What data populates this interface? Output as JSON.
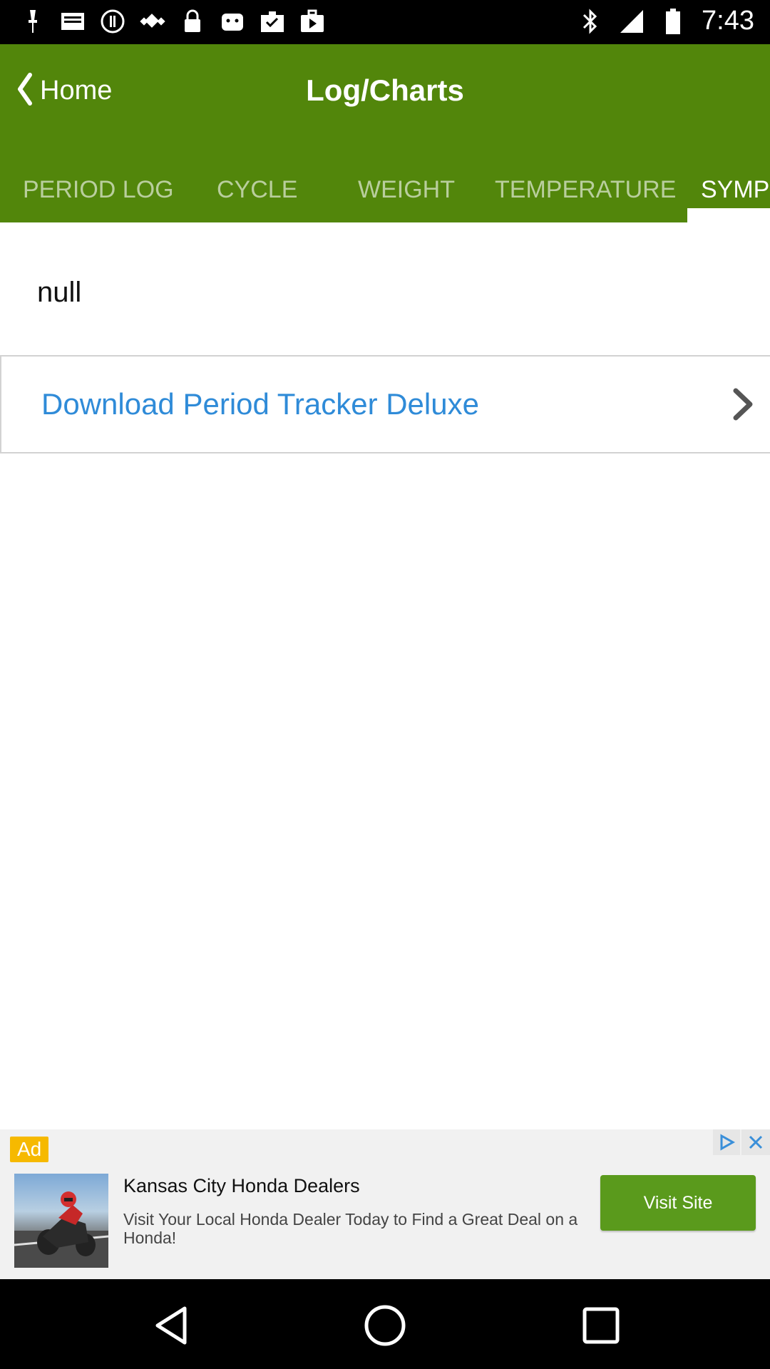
{
  "status_bar": {
    "time": "7:43",
    "left_icons": [
      "notification-icon",
      "mail-icon",
      "alert-icon",
      "fake-gps-icon",
      "lock-icon",
      "android-icon",
      "clipboard-check-icon",
      "play-store-icon"
    ],
    "right_icons": [
      "bluetooth-icon"
    ]
  },
  "header": {
    "back_label": "Home",
    "title": "Log/Charts",
    "background": "#52860b"
  },
  "tabs": [
    {
      "label": "PERIOD LOG",
      "active": false
    },
    {
      "label": "CYCLE",
      "active": false
    },
    {
      "label": "WEIGHT",
      "active": false
    },
    {
      "label": "TEMPERATURE",
      "active": false
    },
    {
      "label": "SYMP",
      "active": true
    }
  ],
  "content": {
    "null_text": "null",
    "download_label": "Download Period Tracker Deluxe",
    "link_color": "#2f8bd8"
  },
  "ad": {
    "badge": "Ad",
    "title": "Kansas City Honda Dealers",
    "description": "Visit Your Local Honda Dealer Today to Find a Great Deal on a Honda!",
    "cta": "Visit Site",
    "cta_color": "#5a9a1c"
  },
  "nav_bar": {
    "buttons": [
      "back-icon",
      "home-icon",
      "recents-icon"
    ]
  }
}
